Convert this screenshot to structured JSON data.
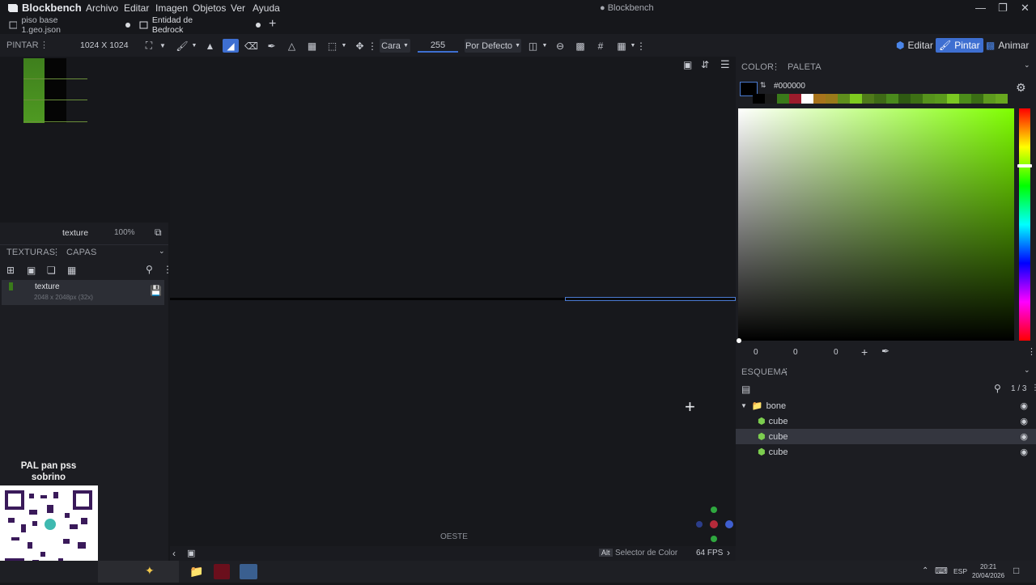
{
  "app": {
    "name": "Blockbench",
    "window_title": "● Blockbench"
  },
  "menu": [
    "Archivo",
    "Editar",
    "Imagen",
    "Objetos",
    "Ver",
    "Ayuda"
  ],
  "tabs": [
    {
      "label": "piso base 1.geo.json",
      "active": false
    },
    {
      "label": "Entidad de Bedrock",
      "active": true
    }
  ],
  "toolbar": {
    "panel_label": "PINTAR",
    "resolution": "1024 X 1024",
    "cara": "Cara",
    "opacity": "255",
    "blend": "Por Defecto"
  },
  "modes": {
    "edit": "Editar",
    "paint": "Pintar",
    "animate": "Animar"
  },
  "texture_preview": {
    "name": "texture",
    "zoom": "100%"
  },
  "textures_panel": {
    "tab1": "TEXTURAS",
    "tab2": "CAPAS",
    "item_name": "texture",
    "item_info": "2048 x 2048px (32x)"
  },
  "color_panel": {
    "tab1": "COLOR",
    "tab2": "PALETA",
    "hex": "#000000",
    "r": "0",
    "g": "0",
    "b": "0",
    "swatches": [
      "#000000",
      "#1a1a1a",
      "#3a7a1a",
      "#9c1c2c",
      "#ffffff",
      "#a8741c",
      "#9a7a1a",
      "#5f8e1c",
      "#7ecb1f",
      "#4f7a1a",
      "#3e6a16",
      "#4a8a1c",
      "#2f5a12",
      "#3d7014",
      "#56921c",
      "#5a9a1c",
      "#7bc822",
      "#4c8c1a",
      "#3a6e14",
      "#5d9a1e",
      "#68a71f"
    ]
  },
  "outliner": {
    "title": "ESQUEMA",
    "count": "1 / 3",
    "items": [
      {
        "label": "bone",
        "type": "folder"
      },
      {
        "label": "cube",
        "type": "cube"
      },
      {
        "label": "cube",
        "type": "cube",
        "selected": true
      },
      {
        "label": "cube",
        "type": "cube"
      }
    ]
  },
  "viewport": {
    "direction": "OESTE"
  },
  "status": {
    "key": "Alt",
    "hint": "Selector de Color",
    "fps": "64 FPS"
  },
  "overlay": {
    "text": "PAL pan pss sobrino"
  },
  "taskbar": {
    "lang": "ESP",
    "time": "20:21",
    "date": "20/04/2026"
  }
}
